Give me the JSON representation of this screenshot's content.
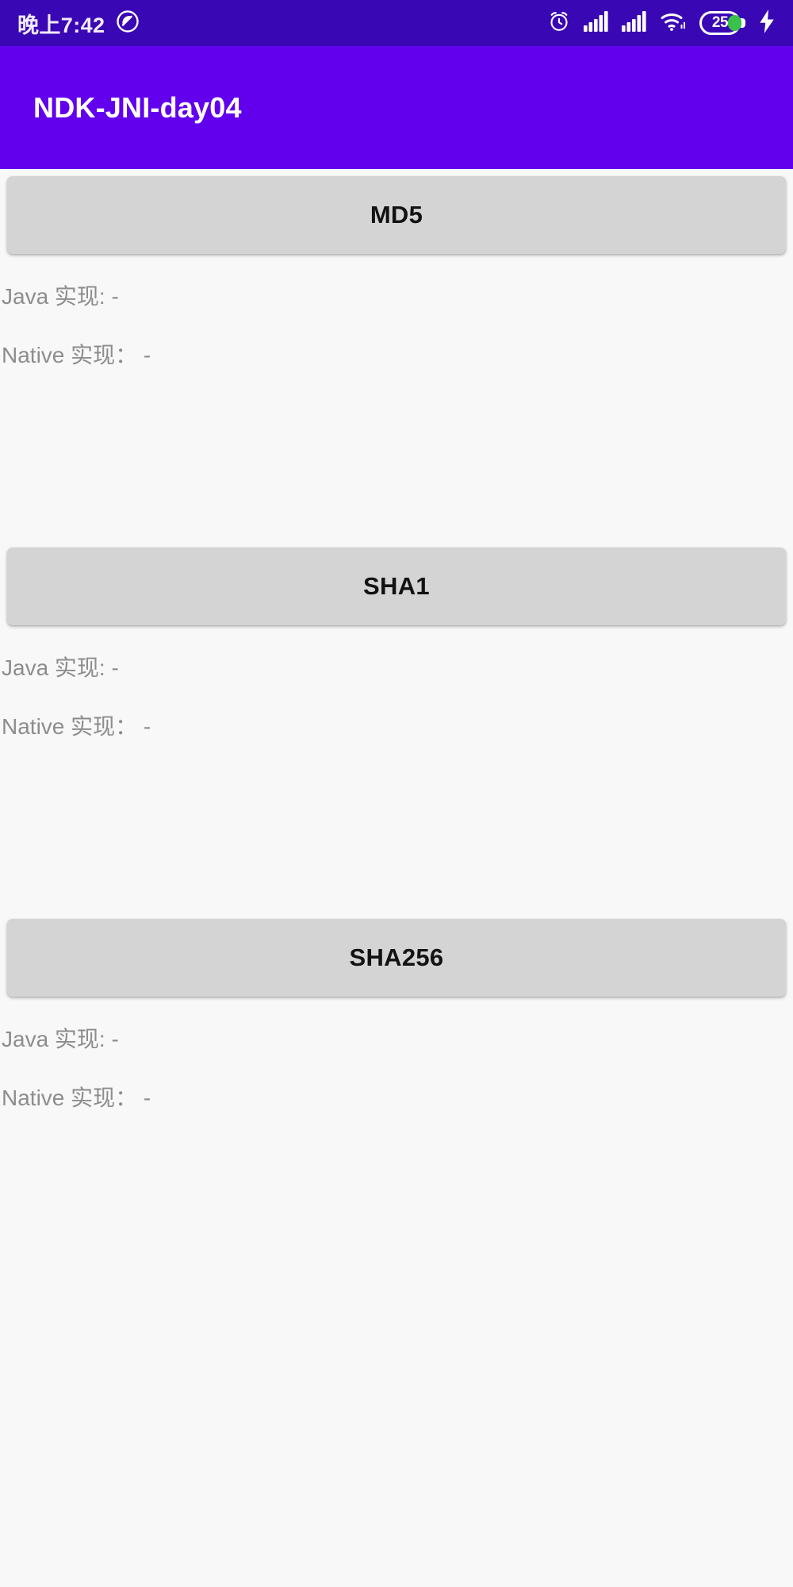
{
  "status_bar": {
    "time": "晚上7:42",
    "left_icons": [
      {
        "name": "loop-recording-icon"
      }
    ],
    "right_icons": [
      {
        "name": "alarm-clock-icon"
      },
      {
        "name": "signal-bars-sim1-icon"
      },
      {
        "name": "signal-bars-sim2-icon"
      },
      {
        "name": "wifi-icon"
      }
    ],
    "battery": {
      "level": "25",
      "charging": true,
      "fill_color": "#39c14b"
    },
    "background_color": "#3a07b5",
    "foreground_color": "#ffffff"
  },
  "app_bar": {
    "title": "NDK-JNI-day04",
    "background_color": "#6200ee",
    "title_color": "#ffffff"
  },
  "content": {
    "background_color": "#f8f8f9",
    "button_color": "#d4d4d4",
    "result_text_color": "#8d8d8d",
    "sections": [
      {
        "button_label": "MD5",
        "java_result": "Java 实现: -",
        "native_result": "Native 实现： -"
      },
      {
        "button_label": "SHA1",
        "java_result": "Java 实现: -",
        "native_result": "Native 实现： -"
      },
      {
        "button_label": "SHA256",
        "java_result": "Java 实现: -",
        "native_result": "Native 实现： -"
      }
    ]
  }
}
